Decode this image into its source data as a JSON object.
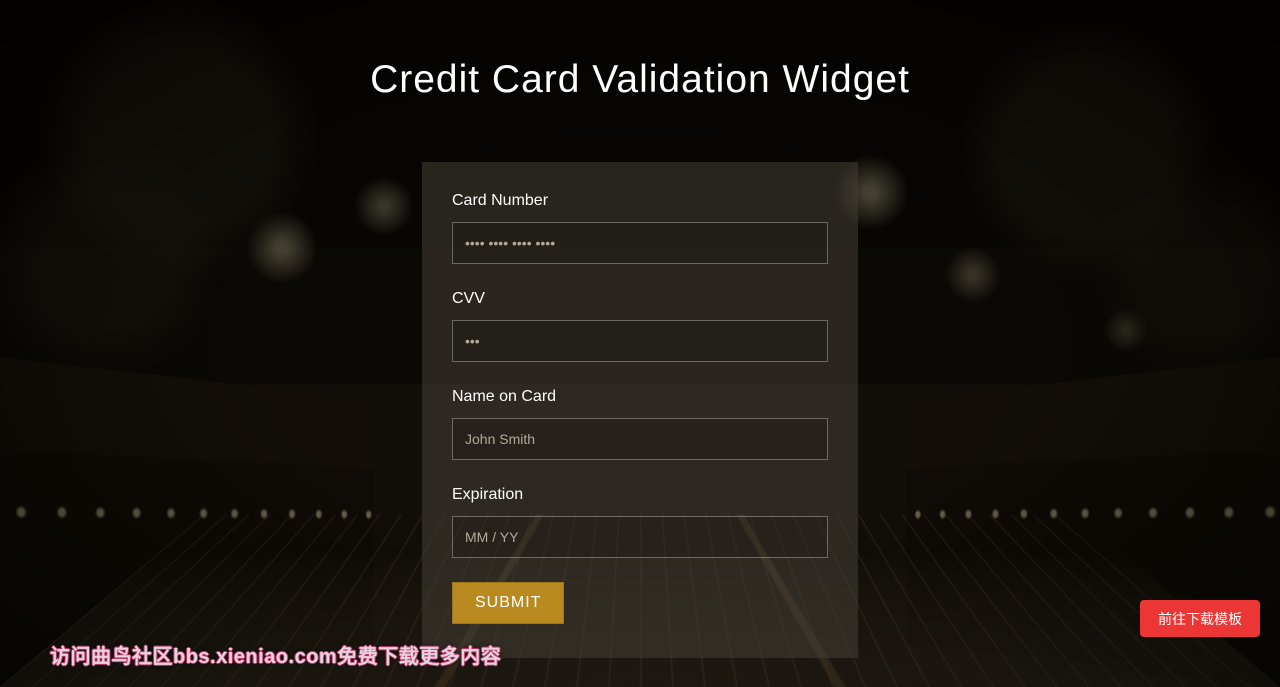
{
  "title": "Credit Card Validation Widget",
  "form": {
    "card_number": {
      "label": "Card Number",
      "placeholder": "•••• •••• •••• ••••",
      "value": ""
    },
    "cvv": {
      "label": "CVV",
      "placeholder": "•••",
      "value": ""
    },
    "name": {
      "label": "Name on Card",
      "placeholder": "John Smith",
      "value": ""
    },
    "expiration": {
      "label": "Expiration",
      "placeholder": "MM / YY",
      "value": ""
    },
    "submit_label": "SUBMIT"
  },
  "download_button_label": "前往下载模板",
  "watermark_text": "访问曲鸟社区bbs.xieniao.com免费下载更多内容",
  "colors": {
    "accent": "#b88a1f",
    "danger": "#ec3535"
  }
}
